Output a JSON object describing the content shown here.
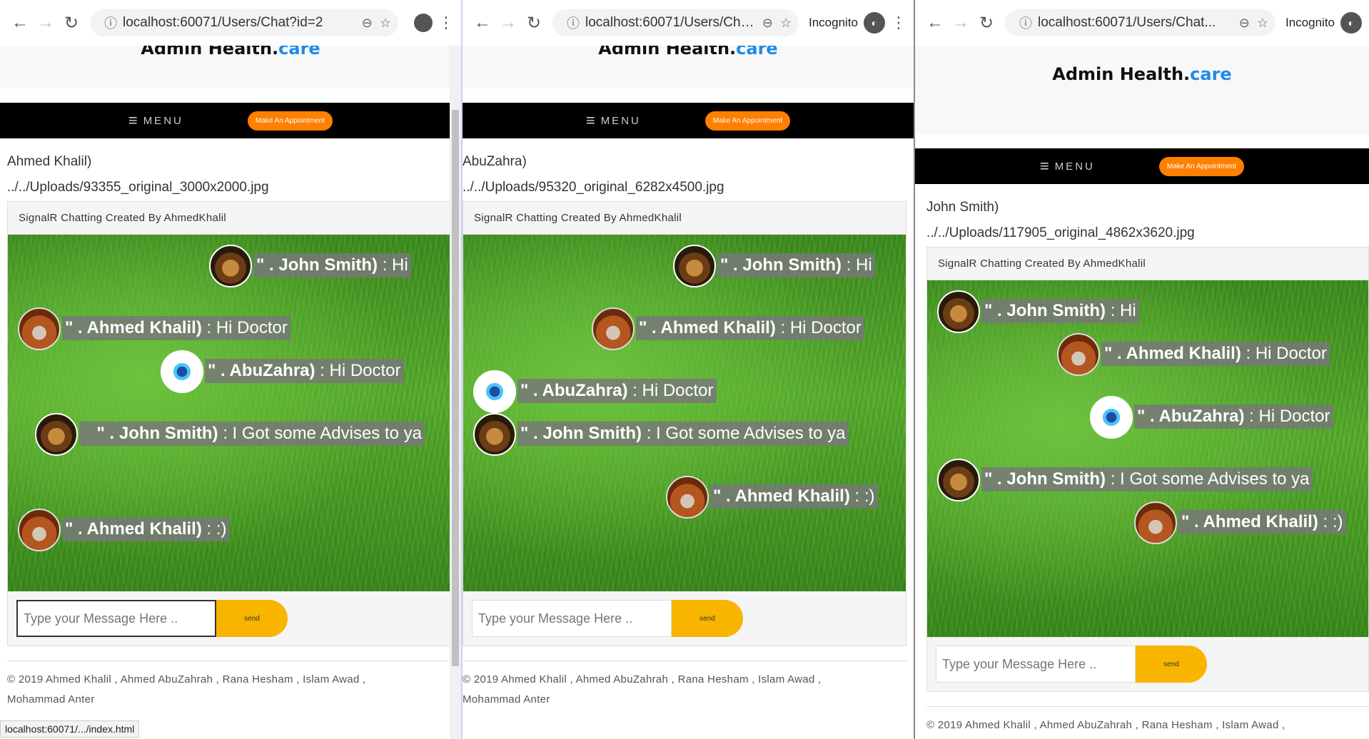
{
  "browser": {
    "win1_url": "localhost:60071/Users/Chat?id=2",
    "win2_url": "localhost:60071/Users/Chat...",
    "win3_url": "localhost:60071/Users/Chat...",
    "incognito_label": "Incognito",
    "status_url": "localhost:60071/.../index.html"
  },
  "site": {
    "brand_main": "Admin Health.",
    "brand_accent": "care",
    "menu_label": "MENU",
    "appointment_label": "Make An Appointment",
    "chat_header": "SignalR Chatting Created By AhmedKhalil",
    "input_placeholder": "Type your Message Here ..",
    "send_label": "send",
    "footer_line1": "© 2019 Ahmed Khalil , Ahmed AbuZahrah , Rana Hesham , Islam Awad ,",
    "footer_line2": "Mohammad Anter",
    "accent_color": "#1e8ae8",
    "appointment_color": "#ff7f00",
    "send_color": "#f7b500"
  },
  "win1": {
    "user_name": "Ahmed Khalil)",
    "user_photo": "../../Uploads/93355_original_3000x2000.jpg"
  },
  "win2": {
    "user_name": "AbuZahra)",
    "user_photo": "../../Uploads/95320_original_6282x4500.jpg"
  },
  "win3": {
    "user_name": "John Smith)",
    "user_photo": "../../Uploads/117905_original_4862x3620.jpg"
  },
  "messages": {
    "m1_sender": "\" . John Smith)",
    "m1_text": " : Hi",
    "m2_sender": "\" . Ahmed Khalil)",
    "m2_text": " : Hi Doctor",
    "m3_sender": "\" . AbuZahra)",
    "m3_text": " : Hi Doctor",
    "m4_sender": "\" . John Smith)",
    "m4_text": " : I Got some Advises to ya",
    "m5_sender": "\" . Ahmed Khalil)",
    "m5_text": " : :)"
  }
}
